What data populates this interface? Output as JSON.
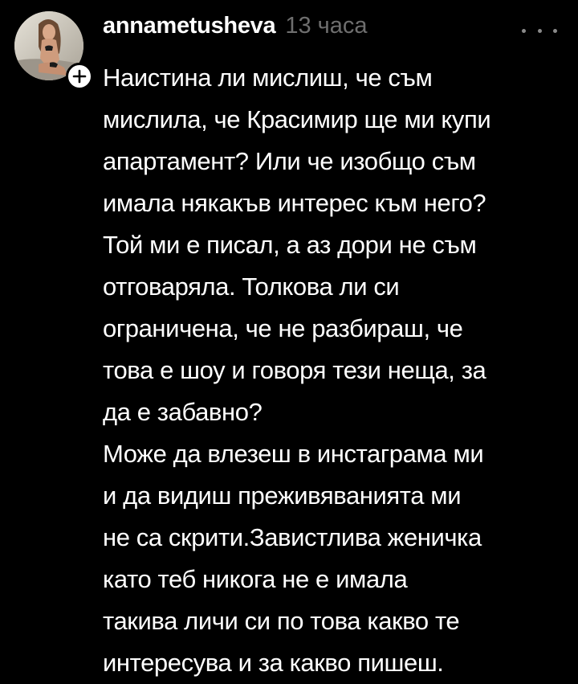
{
  "comment": {
    "username": "annametusheva",
    "timestamp": "13 часа",
    "avatar_icon": "user-avatar",
    "follow_icon": "plus-icon",
    "more_icon": "more-horizontal-icon",
    "text_lines": [
      "Наистина ли мислиш, че съм",
      "мислила, че Красимир ще ми купи",
      "апартамент? Или че изобщо съм",
      "имала някакъв интерес към него?",
      "Той ми е писал, а аз дори не съм",
      "отговаряла. Толкова ли си",
      "ограничена, че не разбираш, че",
      "това е шоу и говоря тези неща, за",
      "да е забавно?",
      "Може да влезеш в инстаграма ми",
      "и да видиш преживяванията ми",
      "не са скрити.Завистлива женичка",
      "като теб никога не е имала",
      "такива личи си по това какво те",
      "интересува и за какво пишеш."
    ]
  },
  "colors": {
    "background": "#000000",
    "text": "#ffffff",
    "timestamp": "#6e6e6e",
    "more_dots": "#8a8a8a"
  }
}
